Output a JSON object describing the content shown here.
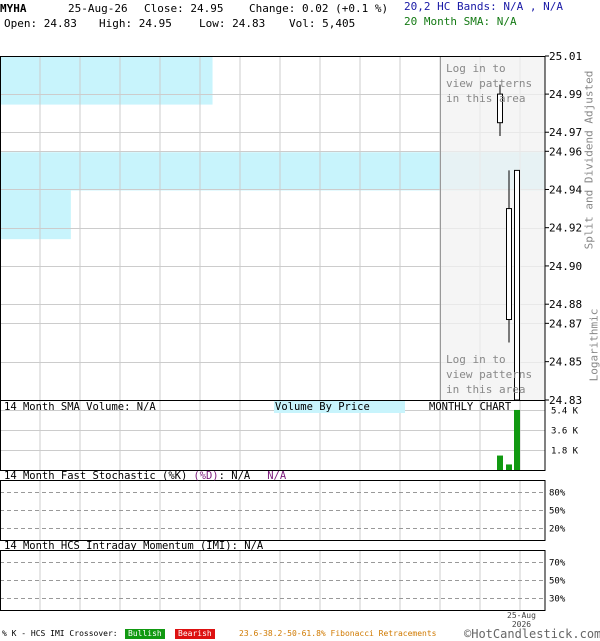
{
  "header": {
    "symbol": "MYHA",
    "date": "25-Aug-26",
    "close_label": "Close: 24.95",
    "change_label": "Change: 0.02 (+0.1 %)",
    "open_label": "Open: 24.83",
    "high_label": "High: 24.95",
    "low_label": "Low: 24.83",
    "vol_label": "Vol: 5,405",
    "bands_label": "20,2 HC Bands: N/A , N/A",
    "sma_label": "20 Month SMA: N/A"
  },
  "side_labels": {
    "split": "Split and Dividend Adjusted",
    "log": "Logarithmic"
  },
  "overlay_text": {
    "top": [
      "Log in to",
      "view patterns",
      "in this area"
    ],
    "bottom": [
      "Log in to",
      "view patterns",
      "in this area"
    ]
  },
  "volume_panel": {
    "title": "14 Month SMA Volume: N/A",
    "vbp": "Volume By Price",
    "monthly": "MONTHLY CHART",
    "ticks": [
      "5.4 K",
      "3.6 K",
      "1.8 K"
    ]
  },
  "stoch_panel": {
    "title_prefix": "14 Month Fast Stochastic (%K)",
    "title_d": "(%D)",
    "title_k_val": ": N/A",
    "title_d_val": "N/A",
    "ticks": [
      "80%",
      "50%",
      "20%"
    ]
  },
  "imi_panel": {
    "title": "14 Month HCS Intraday Momentum (IMI): N/A",
    "ticks": [
      "70%",
      "50%",
      "30%"
    ]
  },
  "xaxis": {
    "label_month": "25-Aug",
    "label_year": "2026"
  },
  "footer": {
    "crossover": "% K - HCS IMI Crossover:",
    "bullish": "Bullish",
    "bearish": "Bearish",
    "fib": "23.6-38.2-50-61.8% Fibonacci Retracements",
    "brand": "©HotCandlestick.com"
  },
  "colors": {
    "vbp": "#c8f4fc",
    "grid": "#cccccc",
    "bullish": "#119911",
    "bearish": "#dd1111",
    "fib": "#d07a00",
    "volume_bar": "#119911",
    "shade": "#f2f2f2"
  },
  "chart_data": {
    "type": "candlestick",
    "scale": "logarithmic",
    "ylim": [
      24.83,
      25.01
    ],
    "price_ticks": [
      25.01,
      24.99,
      24.97,
      24.96,
      24.94,
      24.92,
      24.9,
      24.88,
      24.87,
      24.85,
      24.83
    ],
    "candles": [
      {
        "open": 24.99,
        "high": 24.995,
        "low": 24.968,
        "close": 24.975
      },
      {
        "open": 24.93,
        "high": 24.95,
        "low": 24.86,
        "close": 24.872
      },
      {
        "open": 24.83,
        "high": 24.95,
        "low": 24.83,
        "close": 24.95
      }
    ],
    "volume": {
      "ylim": [
        0,
        5400
      ],
      "values": [
        1300,
        500,
        5405
      ]
    },
    "volume_by_price": [
      {
        "low": 24.9845,
        "high": 25.01,
        "fraction": 0.39
      },
      {
        "low": 24.9395,
        "high": 24.9595,
        "fraction": 1.0
      },
      {
        "low": 24.914,
        "high": 24.9395,
        "fraction": 0.13
      }
    ]
  }
}
